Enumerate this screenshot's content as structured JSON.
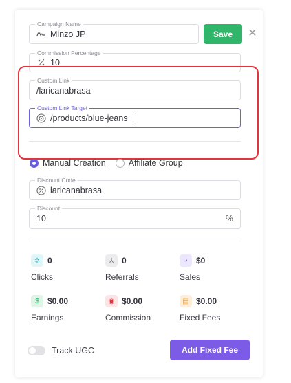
{
  "campaign": {
    "name_label": "Campaign Name",
    "name_value": "Minzo JP",
    "save_label": "Save",
    "close_glyph": "✕"
  },
  "commission": {
    "label": "Commission Percentage",
    "value": "10"
  },
  "custom_link": {
    "label": "Custom Link",
    "value": "/laricanabrasa"
  },
  "custom_link_target": {
    "label": "Custom Link Target",
    "value": "/products/blue-jeans"
  },
  "creation_mode": {
    "options": [
      {
        "label": "Manual Creation",
        "selected": true
      },
      {
        "label": "Affiliate Group",
        "selected": false
      }
    ]
  },
  "discount_code": {
    "label": "Discount Code",
    "value": "laricanabrasa"
  },
  "discount": {
    "label": "Discount",
    "value": "10",
    "unit": "%"
  },
  "stats": [
    {
      "value": "0",
      "label": "Clicks",
      "icon": "click-icon",
      "color": "#36b6c9",
      "bg": "#e0f6f8"
    },
    {
      "value": "0",
      "label": "Referrals",
      "icon": "share-icon",
      "color": "#7a7a82",
      "bg": "#ececef"
    },
    {
      "value": "$0",
      "label": "Sales",
      "icon": "chart-icon",
      "color": "#7c5ce6",
      "bg": "#ece7fd"
    },
    {
      "value": "$0.00",
      "label": "Earnings",
      "icon": "dollar-icon",
      "color": "#2fb66a",
      "bg": "#e0f5e8"
    },
    {
      "value": "$0.00",
      "label": "Commission",
      "icon": "coin-icon",
      "color": "#e0353d",
      "bg": "#fde4e5"
    },
    {
      "value": "$0.00",
      "label": "Fixed Fees",
      "icon": "receipt-icon",
      "color": "#e89a2c",
      "bg": "#fdeedb"
    }
  ],
  "track_ugc": {
    "label": "Track UGC",
    "enabled": false
  },
  "add_fixed_fee_label": "Add Fixed Fee",
  "colors": {
    "accent": "#6a5fe0",
    "save": "#2fb66a",
    "fee_button": "#7c5ce6",
    "highlight": "#e0353d"
  }
}
